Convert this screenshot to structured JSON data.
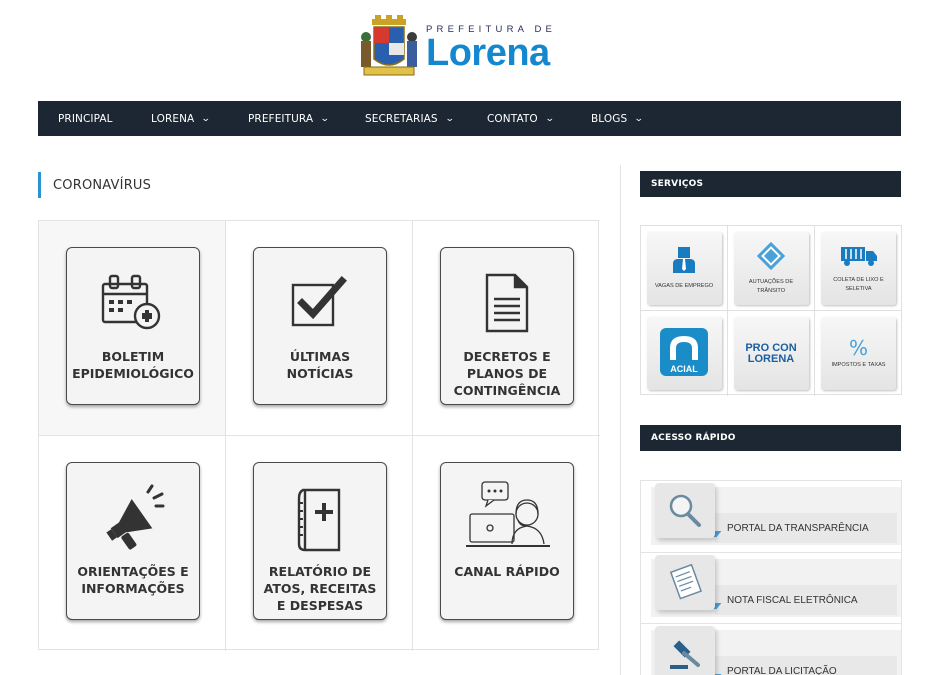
{
  "header": {
    "logo_small": "PREFEITURA DE",
    "logo_big": "Lorena"
  },
  "nav": {
    "items": [
      {
        "label": "PRINCIPAL",
        "dropdown": false
      },
      {
        "label": "LORENA",
        "dropdown": true
      },
      {
        "label": "PREFEITURA",
        "dropdown": true
      },
      {
        "label": "SECRETARIAS",
        "dropdown": true
      },
      {
        "label": "CONTATO",
        "dropdown": true
      },
      {
        "label": "BLOGS",
        "dropdown": true
      }
    ]
  },
  "main": {
    "title": "CORONAVÍRUS",
    "tiles": [
      {
        "label": "BOLETIM EPIDEMIOLÓGICO",
        "icon": "calendar-plus-icon"
      },
      {
        "label": "ÚLTIMAS NOTÍCIAS",
        "icon": "checkbox-icon"
      },
      {
        "label": "DECRETOS E PLANOS DE CONTINGÊNCIA",
        "icon": "document-icon"
      },
      {
        "label": "ORIENTAÇÕES E INFORMAÇÕES",
        "icon": "megaphone-icon"
      },
      {
        "label": "RELATÓRIO DE ATOS, RECEITAS E DESPESAS",
        "icon": "medical-book-icon"
      },
      {
        "label": "CANAL RÁPIDO",
        "icon": "support-agent-icon"
      }
    ]
  },
  "sidebar": {
    "services_title": "SERVIÇOS",
    "services": [
      {
        "label": "VAGAS DE EMPREGO",
        "icon": "worker-icon"
      },
      {
        "label": "AUTUAÇÕES DE TRÂNSITO",
        "icon": "traffic-sign-icon"
      },
      {
        "label": "COLETA DE LIXO E SELETIVA",
        "icon": "garbage-truck-icon"
      },
      {
        "label": "",
        "icon": "acial-logo",
        "logo_text": "ACIAL"
      },
      {
        "label": "",
        "icon": "procon-logo",
        "logo_text": "PRO CON LORENA"
      },
      {
        "label": "IMPOSTOS E TAXAS",
        "icon": "percent-icon"
      }
    ],
    "quick_title": "ACESSO RÁPIDO",
    "quick_links": [
      {
        "label": "PORTAL DA TRANSPARÊNCIA",
        "icon": "magnifier-icon"
      },
      {
        "label": "NOTA FISCAL ELETRÔNICA",
        "icon": "invoice-icon"
      },
      {
        "label": "PORTAL DA LICITAÇÃO",
        "icon": "gavel-icon"
      }
    ]
  },
  "colors": {
    "nav_bg": "#1d2733",
    "accent": "#2b93cf",
    "logo_blue": "#1587cf"
  }
}
